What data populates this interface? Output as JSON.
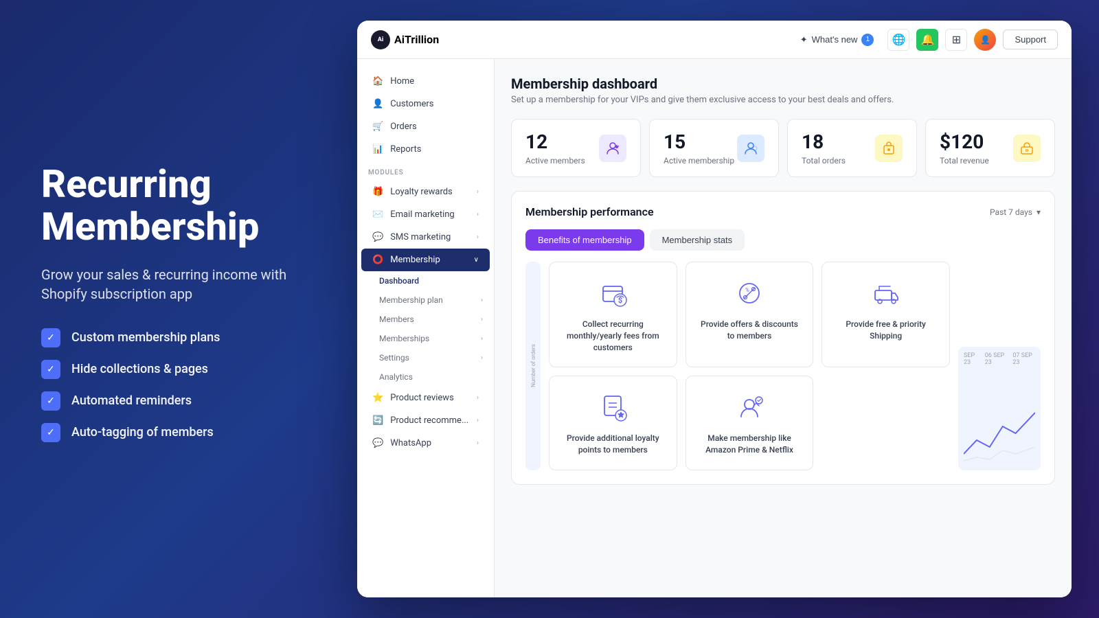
{
  "page": {
    "background_color": "#1a2a6c"
  },
  "left": {
    "heading_line1": "Recurring",
    "heading_line2": "Membership",
    "subtitle": "Grow your sales & recurring income with Shopify subscription app",
    "features": [
      "Custom membership plans",
      "Hide collections & pages",
      "Automated reminders",
      "Auto-tagging of members"
    ]
  },
  "topbar": {
    "logo_text": "AiTrillion",
    "logo_icon": "Ai",
    "whats_new_label": "What's new",
    "whats_new_count": "1",
    "support_label": "Support"
  },
  "sidebar": {
    "nav_items": [
      {
        "label": "Home",
        "icon": "🏠"
      },
      {
        "label": "Customers",
        "icon": "👤"
      },
      {
        "label": "Orders",
        "icon": "🛒"
      },
      {
        "label": "Reports",
        "icon": "📊"
      }
    ],
    "modules_label": "MODULES",
    "module_items": [
      {
        "label": "Loyalty rewards",
        "has_arrow": true
      },
      {
        "label": "Email marketing",
        "has_arrow": true
      },
      {
        "label": "SMS marketing",
        "has_arrow": true
      },
      {
        "label": "Membership",
        "active": true,
        "has_arrow": true
      }
    ],
    "membership_sub": [
      {
        "label": "Dashboard",
        "active": true
      },
      {
        "label": "Membership plan",
        "has_arrow": true
      },
      {
        "label": "Members",
        "has_arrow": true
      },
      {
        "label": "Memberships",
        "has_arrow": true
      },
      {
        "label": "Settings",
        "has_arrow": true
      },
      {
        "label": "Analytics"
      }
    ],
    "bottom_items": [
      {
        "label": "Product reviews",
        "has_arrow": true
      },
      {
        "label": "Product recomme...",
        "has_arrow": true
      },
      {
        "label": "WhatsApp",
        "has_arrow": true
      }
    ]
  },
  "content": {
    "title": "Membership dashboard",
    "subtitle": "Set up a membership for your VIPs and give them exclusive access to your best deals and offers.",
    "stats": [
      {
        "number": "12",
        "label": "Active members",
        "icon_type": "purple"
      },
      {
        "number": "15",
        "label": "Active membership",
        "icon_type": "blue"
      },
      {
        "number": "18",
        "label": "Total orders",
        "icon_type": "yellow"
      },
      {
        "number": "$120",
        "label": "Total revenue",
        "icon_type": "yellow"
      }
    ],
    "performance": {
      "title": "Membership performance",
      "date_filter": "Past 7 days"
    },
    "tabs": [
      {
        "label": "Benefits of membership",
        "active": true
      },
      {
        "label": "Membership stats",
        "active": false
      }
    ],
    "benefit_cards": [
      {
        "text": "Collect recurring monthly/yearly fees from customers",
        "icon_name": "dollar-recurring-icon"
      },
      {
        "text": "Provide offers & discounts to members",
        "icon_name": "discount-icon"
      },
      {
        "text": "Provide free & priority Shipping",
        "icon_name": "shipping-icon"
      },
      {
        "text": "Provide additional loyalty points to members",
        "icon_name": "loyalty-points-icon"
      },
      {
        "text": "Make membership like Amazon Prime & Netflix",
        "icon_name": "prime-membership-icon"
      }
    ],
    "chart_labels": [
      "SEP 23",
      "06 SEP 23",
      "07 SEP 23"
    ]
  }
}
